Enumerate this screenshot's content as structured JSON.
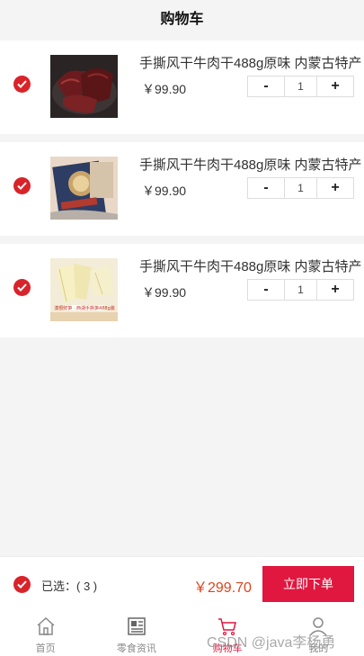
{
  "header": {
    "title": "购物车"
  },
  "items": [
    {
      "name": "手撕风干牛肉干488g原味 内蒙古特产",
      "price": "￥99.90",
      "qty": "1",
      "minus": "-",
      "plus": "+"
    },
    {
      "name": "手撕风干牛肉干488g原味 内蒙古特产",
      "price": "￥99.90",
      "qty": "1",
      "minus": "-",
      "plus": "+"
    },
    {
      "name": "手撕风干牛肉干488g原味 内蒙古特产",
      "price": "￥99.90",
      "qty": "1",
      "minus": "-",
      "plus": "+"
    }
  ],
  "images": {
    "item1_caption": "",
    "item3_caption": "澳根鲜笋 · 西湖手撕笋488g装"
  },
  "footer": {
    "selected_label": "已选：( 3 )",
    "total": "￥299.70",
    "order_button": "立即下单"
  },
  "tabbar": {
    "tabs": [
      {
        "label": "首页",
        "icon": "home-icon"
      },
      {
        "label": "零食资讯",
        "icon": "news-icon"
      },
      {
        "label": "购物车",
        "icon": "cart-icon",
        "active": true
      },
      {
        "label": "我的",
        "icon": "user-icon"
      }
    ]
  },
  "watermark": "CSDN @java李杨勇",
  "colors": {
    "accent": "#e0173f",
    "check": "#d9232a",
    "price_total": "#e0441d"
  }
}
